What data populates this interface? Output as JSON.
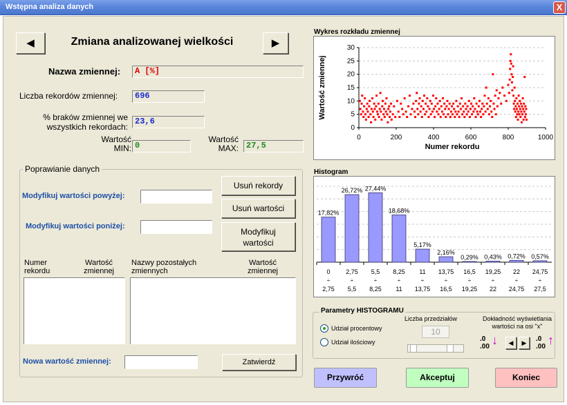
{
  "window": {
    "title": "Wstępna analiza danych",
    "close": "X"
  },
  "nav": {
    "prev": "◀",
    "next": "▶",
    "heading": "Zmiana analizowanej wielkości"
  },
  "variable": {
    "name_label": "Nazwa zmiennej:",
    "name_value": "A [%]"
  },
  "stats": {
    "records_label": "Liczba rekordów zmiennej:",
    "records_value": "696",
    "missing_label_1": "% braków zmiennej we",
    "missing_label_2": "wszystkich rekordach:",
    "missing_value": "23,6",
    "min_label_1": "Wartość",
    "min_label_2": "MIN:",
    "min_value": "0",
    "max_label_1": "Wartość",
    "max_label_2": "MAX:",
    "max_value": "27,5"
  },
  "fix": {
    "group_label": "Poprawianie danych",
    "modify_above_label": "Modyfikuj wartości powyżej:",
    "modify_above_value": "",
    "modify_below_label": "Modyfikuj wartości poniżej:",
    "modify_below_value": "",
    "remove_records": "Usuń rekordy",
    "remove_values": "Usuń wartości",
    "modify_values_1": "Modyfikuj",
    "modify_values_2": "wartości",
    "col_record_1": "Numer",
    "col_record_2": "rekordu",
    "col_value_1": "Wartość",
    "col_value_2": "zmiennej",
    "col_other_1": "Nazwy pozostałych",
    "col_other_2": "zmiennych",
    "col_value2_1": "Wartość",
    "col_value2_2": "zmiennej",
    "new_value_label": "Nowa wartość zmiennej:",
    "new_value": "",
    "confirm": "Zatwierdź"
  },
  "scatter_panel": {
    "title": "Wykres rozkładu zmiennej"
  },
  "histogram_panel": {
    "title": "Histogram"
  },
  "params": {
    "title": "Parametry HISTOGRAMU",
    "radio_percent": "Udział procentowy",
    "radio_count": "Udział ilościowy",
    "intervals_label": "Liczba przedziałów",
    "intervals_value": "10",
    "precision_label_1": "Dokładność wyświetlania",
    "precision_label_2": "wartości na osi \"x\"",
    "dec_a": ".0",
    "dec_b": ".00",
    "inc_a": ".0",
    "inc_b": ".00",
    "left": "◀",
    "right": "▶"
  },
  "footer": {
    "restore": "Przywróć",
    "accept": "Akceptuj",
    "end": "Koniec"
  },
  "colors": {
    "scatter": "#ff0000",
    "bars": "#9999ff",
    "restore": "#c0c0ff",
    "accept": "#c0ffc0",
    "end": "#ffc0c0",
    "arrows": "#cc00cc"
  },
  "chart_data": [
    {
      "type": "scatter",
      "xlabel": "Numer rekordu",
      "ylabel": "Wartość zmiennej",
      "xlim": [
        0,
        1000
      ],
      "ylim": [
        0,
        30
      ],
      "xticks": [
        0,
        200,
        400,
        600,
        800,
        1000
      ],
      "yticks": [
        0,
        5,
        10,
        15,
        20,
        25,
        30
      ],
      "grid": "horizontal-dashed",
      "points": [
        [
          5,
          10
        ],
        [
          8,
          7
        ],
        [
          12,
          5
        ],
        [
          15,
          9
        ],
        [
          18,
          12
        ],
        [
          22,
          6
        ],
        [
          25,
          4
        ],
        [
          28,
          8
        ],
        [
          32,
          11
        ],
        [
          35,
          5
        ],
        [
          38,
          3
        ],
        [
          42,
          7
        ],
        [
          45,
          9
        ],
        [
          48,
          6
        ],
        [
          52,
          4
        ],
        [
          55,
          8
        ],
        [
          58,
          10
        ],
        [
          62,
          5
        ],
        [
          65,
          2
        ],
        [
          68,
          7
        ],
        [
          72,
          11
        ],
        [
          75,
          6
        ],
        [
          78,
          4
        ],
        [
          82,
          9
        ],
        [
          85,
          7
        ],
        [
          88,
          3
        ],
        [
          92,
          8
        ],
        [
          95,
          12
        ],
        [
          98,
          6
        ],
        [
          102,
          5
        ],
        [
          105,
          9
        ],
        [
          108,
          4
        ],
        [
          112,
          7
        ],
        [
          115,
          13
        ],
        [
          118,
          6
        ],
        [
          122,
          3
        ],
        [
          125,
          8
        ],
        [
          128,
          10
        ],
        [
          132,
          5
        ],
        [
          135,
          7
        ],
        [
          138,
          4
        ],
        [
          142,
          9
        ],
        [
          145,
          6
        ],
        [
          148,
          11
        ],
        [
          152,
          5
        ],
        [
          155,
          2
        ],
        [
          158,
          7
        ],
        [
          162,
          8
        ],
        [
          165,
          4
        ],
        [
          168,
          6
        ],
        [
          172,
          9
        ],
        [
          175,
          3
        ],
        [
          182,
          5
        ],
        [
          188,
          8
        ],
        [
          195,
          4
        ],
        [
          205,
          10
        ],
        [
          212,
          6
        ],
        [
          218,
          4
        ],
        [
          225,
          9
        ],
        [
          232,
          7
        ],
        [
          238,
          5
        ],
        [
          245,
          11
        ],
        [
          252,
          6
        ],
        [
          258,
          4
        ],
        [
          265,
          8
        ],
        [
          272,
          12
        ],
        [
          278,
          5
        ],
        [
          285,
          7
        ],
        [
          292,
          9
        ],
        [
          298,
          6
        ],
        [
          302,
          4
        ],
        [
          306,
          10
        ],
        [
          310,
          13
        ],
        [
          314,
          7
        ],
        [
          318,
          5
        ],
        [
          322,
          9
        ],
        [
          326,
          11
        ],
        [
          330,
          6
        ],
        [
          334,
          8
        ],
        [
          338,
          4
        ],
        [
          342,
          10
        ],
        [
          346,
          7
        ],
        [
          350,
          12
        ],
        [
          354,
          5
        ],
        [
          358,
          9
        ],
        [
          362,
          6
        ],
        [
          366,
          11
        ],
        [
          370,
          8
        ],
        [
          374,
          4
        ],
        [
          378,
          7
        ],
        [
          382,
          10
        ],
        [
          386,
          5
        ],
        [
          390,
          9
        ],
        [
          394,
          6
        ],
        [
          398,
          12
        ],
        [
          402,
          7
        ],
        [
          406,
          4
        ],
        [
          410,
          8
        ],
        [
          414,
          11
        ],
        [
          418,
          6
        ],
        [
          422,
          9
        ],
        [
          426,
          5
        ],
        [
          430,
          7
        ],
        [
          434,
          10
        ],
        [
          438,
          4
        ],
        [
          442,
          8
        ],
        [
          446,
          6
        ],
        [
          450,
          11
        ],
        [
          454,
          5
        ],
        [
          458,
          9
        ],
        [
          462,
          7
        ],
        [
          466,
          4
        ],
        [
          470,
          8
        ],
        [
          474,
          10
        ],
        [
          478,
          5
        ],
        [
          482,
          7
        ],
        [
          486,
          9
        ],
        [
          490,
          4
        ],
        [
          494,
          6
        ],
        [
          498,
          8
        ],
        [
          502,
          5
        ],
        [
          506,
          9
        ],
        [
          510,
          7
        ],
        [
          514,
          4
        ],
        [
          518,
          6
        ],
        [
          522,
          10
        ],
        [
          526,
          5
        ],
        [
          530,
          8
        ],
        [
          534,
          6
        ],
        [
          538,
          4
        ],
        [
          542,
          9
        ],
        [
          546,
          7
        ],
        [
          550,
          11
        ],
        [
          554,
          5
        ],
        [
          558,
          8
        ],
        [
          562,
          6
        ],
        [
          566,
          4
        ],
        [
          570,
          9
        ],
        [
          574,
          7
        ],
        [
          578,
          5
        ],
        [
          582,
          8
        ],
        [
          586,
          6
        ],
        [
          590,
          10
        ],
        [
          594,
          4
        ],
        [
          598,
          7
        ],
        [
          602,
          9
        ],
        [
          606,
          5
        ],
        [
          610,
          8
        ],
        [
          614,
          6
        ],
        [
          618,
          11
        ],
        [
          622,
          7
        ],
        [
          626,
          4
        ],
        [
          630,
          9
        ],
        [
          634,
          6
        ],
        [
          638,
          5
        ],
        [
          642,
          8
        ],
        [
          646,
          10
        ],
        [
          650,
          6
        ],
        [
          654,
          4
        ],
        [
          658,
          7
        ],
        [
          662,
          9
        ],
        [
          666,
          5
        ],
        [
          670,
          8
        ],
        [
          674,
          12
        ],
        [
          678,
          6
        ],
        [
          682,
          15
        ],
        [
          686,
          9
        ],
        [
          690,
          7
        ],
        [
          694,
          11
        ],
        [
          698,
          5
        ],
        [
          702,
          8
        ],
        [
          706,
          10
        ],
        [
          710,
          6
        ],
        [
          714,
          4
        ],
        [
          718,
          20
        ],
        [
          722,
          9
        ],
        [
          726,
          7
        ],
        [
          730,
          12
        ],
        [
          734,
          5
        ],
        [
          738,
          14
        ],
        [
          742,
          8
        ],
        [
          748,
          11
        ],
        [
          755,
          13
        ],
        [
          762,
          9
        ],
        [
          770,
          15
        ],
        [
          780,
          12
        ],
        [
          790,
          10
        ],
        [
          800,
          16
        ],
        [
          805,
          13
        ],
        [
          808,
          18
        ],
        [
          810,
          22
        ],
        [
          812,
          25
        ],
        [
          814,
          27.5
        ],
        [
          816,
          24
        ],
        [
          818,
          20
        ],
        [
          820,
          17
        ],
        [
          822,
          14
        ],
        [
          824,
          19
        ],
        [
          826,
          23
        ],
        [
          828,
          12
        ],
        [
          830,
          9
        ],
        [
          832,
          7
        ],
        [
          834,
          15
        ],
        [
          836,
          10
        ],
        [
          838,
          6
        ],
        [
          840,
          8
        ],
        [
          842,
          4
        ],
        [
          844,
          11
        ],
        [
          846,
          7
        ],
        [
          848,
          5
        ],
        [
          850,
          9
        ],
        [
          852,
          3
        ],
        [
          854,
          6
        ],
        [
          856,
          12
        ],
        [
          858,
          8
        ],
        [
          860,
          5
        ],
        [
          862,
          10
        ],
        [
          864,
          7
        ],
        [
          866,
          4
        ],
        [
          868,
          9
        ],
        [
          870,
          6
        ],
        [
          872,
          2
        ],
        [
          874,
          8
        ],
        [
          876,
          5
        ],
        [
          878,
          11
        ],
        [
          880,
          7
        ],
        [
          882,
          3
        ],
        [
          884,
          9
        ],
        [
          886,
          6
        ],
        [
          888,
          19
        ],
        [
          890,
          4
        ],
        [
          892,
          8
        ],
        [
          894,
          5
        ],
        [
          896,
          7
        ],
        [
          898,
          3
        ]
      ]
    },
    {
      "type": "bar",
      "categories": [
        "0 ÷ 2,75",
        "2,75 ÷ 5,5",
        "5,5 ÷ 8,25",
        "8,25 ÷ 11",
        "11 ÷ 13,75",
        "13,75 ÷ 16,5",
        "16,5 ÷ 19,25",
        "19,25 ÷ 22",
        "22 ÷ 24,75",
        "24,75 ÷ 27,5"
      ],
      "cat_top": [
        "0",
        "2,75",
        "5,5",
        "8,25",
        "11",
        "13,75",
        "16,5",
        "19,25",
        "22",
        "24,75"
      ],
      "cat_bottom": [
        "2,75",
        "5,5",
        "8,25",
        "11",
        "13,75",
        "16,5",
        "19,25",
        "22",
        "24,75",
        "27,5"
      ],
      "sep": "÷",
      "values": [
        17.82,
        26.72,
        27.44,
        18.68,
        5.17,
        2.16,
        0.29,
        0.43,
        0.72,
        0.57
      ],
      "value_labels": [
        "17,82%",
        "26,72%",
        "27,44%",
        "18,68%",
        "5,17%",
        "2,16%",
        "0,29%",
        "0,43%",
        "0,72%",
        "0,57%"
      ],
      "ylim": [
        0,
        30
      ],
      "grid": "horizontal-dashed"
    }
  ]
}
